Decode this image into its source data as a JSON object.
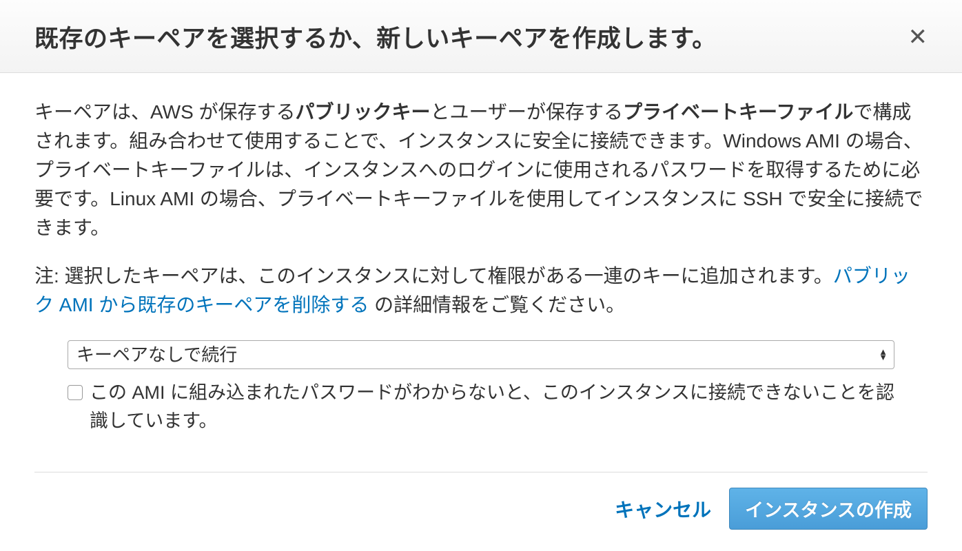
{
  "modal": {
    "title": "既存のキーペアを選択するか、新しいキーペアを作成します。",
    "description": {
      "part1": "キーペアは、AWS が保存する",
      "bold1": "パブリックキー",
      "part2": "とユーザーが保存する",
      "bold2": "プライベートキーファイル",
      "part3": "で構成されます。組み合わせて使用することで、インスタンスに安全に接続できます。Windows AMI の場合、プライベートキーファイルは、インスタンスへのログインに使用されるパスワードを取得するために必要です。Linux AMI の場合、プライベートキーファイルを使用してインスタンスに SSH で安全に接続できます。"
    },
    "note": {
      "prefix": "注: 選択したキーペアは、このインスタンスに対して権限がある一連のキーに追加されます。",
      "link_text": "パブリック AMI から既存のキーペアを削除する",
      "suffix": " の詳細情報をご覧ください。"
    },
    "keypair_select": {
      "selected": "キーペアなしで続行"
    },
    "acknowledge_checkbox": {
      "label": "この AMI に組み込まれたパスワードがわからないと、このインスタンスに接続できないことを認識しています。"
    },
    "footer": {
      "cancel": "キャンセル",
      "launch": "インスタンスの作成"
    }
  }
}
